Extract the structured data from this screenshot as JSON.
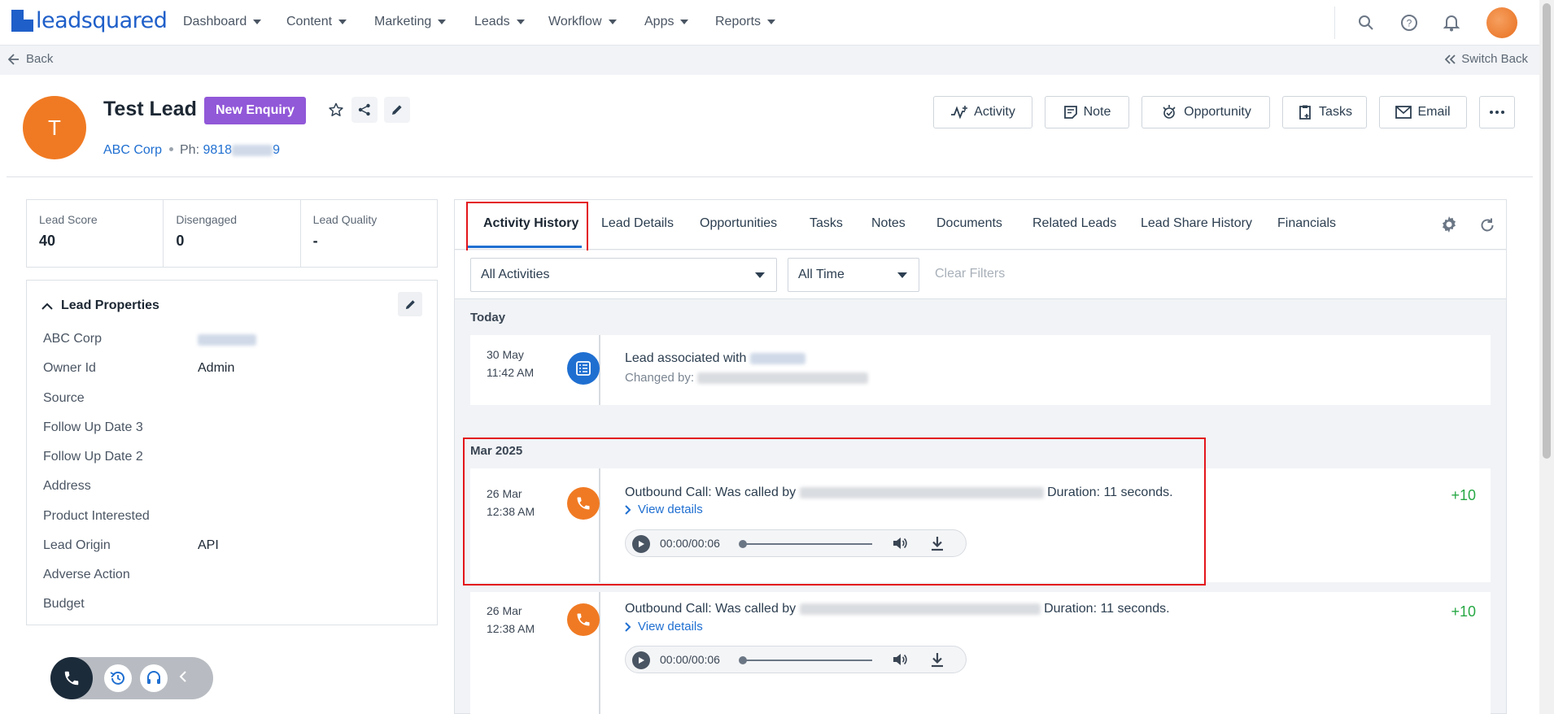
{
  "brand": {
    "logo_text": "leadsquared",
    "accent": "#1f5fc9"
  },
  "nav": {
    "items": [
      {
        "label": "Dashboard"
      },
      {
        "label": "Content"
      },
      {
        "label": "Marketing"
      },
      {
        "label": "Leads"
      },
      {
        "label": "Workflow"
      },
      {
        "label": "Apps"
      },
      {
        "label": "Reports"
      }
    ],
    "icons": [
      "search-icon",
      "help-icon",
      "bell-icon"
    ]
  },
  "subbar": {
    "back_label": "Back",
    "switch_back_label": "Switch Back"
  },
  "lead": {
    "initial": "T",
    "name": "Test Lead",
    "stage": "New Enquiry",
    "company": "ABC Corp",
    "phone_prefix": "Ph:",
    "phone_visible": "9818",
    "phone_end": "9"
  },
  "actions": [
    {
      "label": "Activity",
      "icon": "activity-icon"
    },
    {
      "label": "Note",
      "icon": "note-icon"
    },
    {
      "label": "Opportunity",
      "icon": "opportunity-icon"
    },
    {
      "label": "Tasks",
      "icon": "tasks-icon"
    },
    {
      "label": "Email",
      "icon": "email-icon"
    }
  ],
  "scores": [
    {
      "label": "Lead Score",
      "value": "40"
    },
    {
      "label": "Disengaged",
      "value": "0"
    },
    {
      "label": "Lead Quality",
      "value": "-"
    }
  ],
  "properties": {
    "title": "Lead Properties",
    "rows": [
      {
        "label": "ABC Corp",
        "value": ""
      },
      {
        "label": "Owner Id",
        "value": "Admin"
      },
      {
        "label": "Source",
        "value": ""
      },
      {
        "label": "Follow Up Date 3",
        "value": ""
      },
      {
        "label": "Follow Up Date 2",
        "value": ""
      },
      {
        "label": "Address",
        "value": ""
      },
      {
        "label": "Product Interested",
        "value": ""
      },
      {
        "label": "Lead Origin",
        "value": "API"
      },
      {
        "label": "Adverse Action",
        "value": ""
      },
      {
        "label": "Budget",
        "value": ""
      }
    ]
  },
  "tabs": [
    {
      "label": "Activity History"
    },
    {
      "label": "Lead Details"
    },
    {
      "label": "Opportunities"
    },
    {
      "label": "Tasks"
    },
    {
      "label": "Notes"
    },
    {
      "label": "Documents"
    },
    {
      "label": "Related Leads"
    },
    {
      "label": "Lead Share History"
    },
    {
      "label": "Financials"
    }
  ],
  "filters": {
    "activity_select": "All Activities",
    "time_select": "All Time",
    "clear_label": "Clear Filters"
  },
  "groups": {
    "today": "Today",
    "mar2025": "Mar 2025"
  },
  "activities": [
    {
      "date": "30 May",
      "time": "11:42 AM",
      "text": "Lead associated with",
      "sub": "Changed by:"
    },
    {
      "date": "26 Mar",
      "time": "12:38 AM",
      "text_prefix": "Outbound Call: Was called by",
      "text_suffix": "Duration: 11 seconds.",
      "view_details": "View details",
      "player_time": "00:00/00:06",
      "score": "+10"
    },
    {
      "date": "26 Mar",
      "time": "12:38 AM",
      "text_prefix": "Outbound Call: Was called by",
      "text_suffix": "Duration: 11 seconds.",
      "view_details": "View details",
      "player_time": "00:00/00:06",
      "score": "+10"
    }
  ],
  "colors": {
    "lead_avatar": "#f07a23",
    "stage_badge": "#9158d8",
    "link": "#1f6fd1",
    "score_positive": "#27a844",
    "highlight": "#e3151b"
  }
}
